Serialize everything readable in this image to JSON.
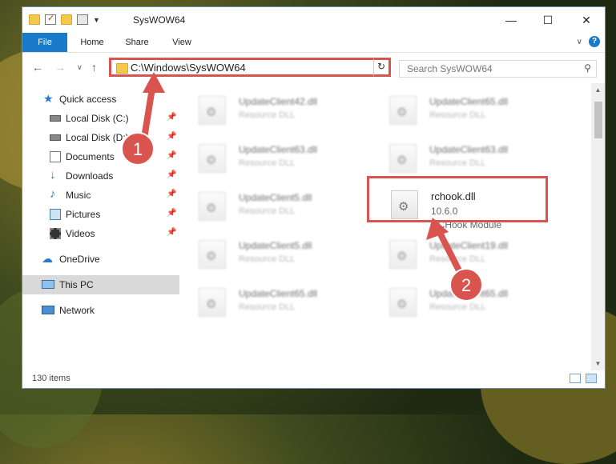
{
  "window": {
    "title": "SysWOW64",
    "controls": {
      "minimize": "—",
      "maximize": "☐",
      "close": "✕"
    },
    "quick_access_toolbar": [
      "folder-icon",
      "properties-check-icon",
      "new-folder-icon",
      "customize-icon"
    ]
  },
  "ribbon": {
    "tabs": [
      "File",
      "Home",
      "Share",
      "View"
    ],
    "expand": "∨",
    "help": "?"
  },
  "navigation": {
    "back": "←",
    "forward": "→",
    "recent": "∨",
    "up": "↑",
    "address": "C:\\Windows\\SysWOW64",
    "address_dropdown": "∨",
    "refresh": "↻",
    "search_placeholder": "Search SysWOW64",
    "search_icon": "⚲"
  },
  "sidebar": {
    "items": [
      {
        "label": "Quick access",
        "icon": "star-icon",
        "pinned": false
      },
      {
        "label": "Local Disk (C:)",
        "icon": "drive-icon",
        "pinned": true
      },
      {
        "label": "Local Disk (D:)",
        "icon": "drive-icon",
        "pinned": true
      },
      {
        "label": "Documents",
        "icon": "documents-icon",
        "pinned": true
      },
      {
        "label": "Downloads",
        "icon": "downloads-icon",
        "pinned": true
      },
      {
        "label": "Music",
        "icon": "music-icon",
        "pinned": true
      },
      {
        "label": "Pictures",
        "icon": "pictures-icon",
        "pinned": true
      },
      {
        "label": "Videos",
        "icon": "videos-icon",
        "pinned": true
      },
      {
        "label": "OneDrive",
        "icon": "cloud-icon",
        "pinned": false
      },
      {
        "label": "This PC",
        "icon": "computer-icon",
        "pinned": false,
        "selected": true
      },
      {
        "label": "Network",
        "icon": "network-icon",
        "pinned": false
      }
    ]
  },
  "files": [
    {
      "name": "UpdateClient42.dll",
      "sub": "Resource DLL"
    },
    {
      "name": "UpdateClient65.dll",
      "sub": "Resource DLL"
    },
    {
      "name": "UpdateClient63.dll",
      "sub": "Resource DLL"
    },
    {
      "name": "UpdateClient63.dll",
      "sub": "Resource DLL"
    },
    {
      "name": "UpdateClient5.dll",
      "sub": "Resource DLL"
    },
    {
      "name": "rchook.dll",
      "version": "10.6.0",
      "sub": "RCHook Module",
      "highlighted": true
    },
    {
      "name": "UpdateClient5.dll",
      "sub": "Resource DLL"
    },
    {
      "name": "UpdateClient19.dll",
      "sub": "Resource DLL"
    },
    {
      "name": "UpdateClient65.dll",
      "sub": "Resource DLL"
    },
    {
      "name": "UpdateClient65.dll",
      "sub": "Resource DLL"
    }
  ],
  "status": {
    "count": "130 items"
  },
  "annotations": {
    "step1": "1",
    "step2": "2",
    "accent": "#d9534f"
  },
  "colors": {
    "file_tab": "#1979ca",
    "selection": "#d9d9d9"
  }
}
